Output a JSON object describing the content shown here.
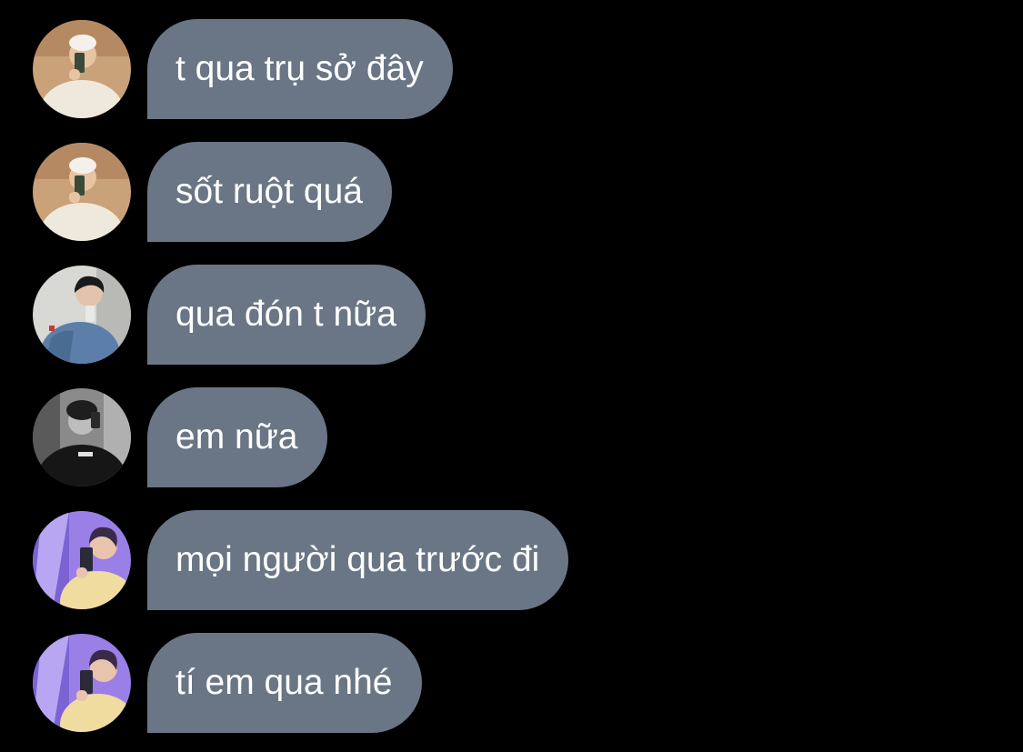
{
  "conversation": {
    "messages": [
      {
        "avatar": "user-a-avatar",
        "text": "t qua trụ sở đây"
      },
      {
        "avatar": "user-a-avatar",
        "text": "sốt ruột quá"
      },
      {
        "avatar": "user-b-avatar",
        "text": "qua đón t nữa"
      },
      {
        "avatar": "user-c-avatar",
        "text": "em nữa"
      },
      {
        "avatar": "user-d-avatar",
        "text": "mọi người qua trước đi"
      },
      {
        "avatar": "user-d-avatar",
        "text": "tí em qua nhé"
      }
    ]
  },
  "colors": {
    "background": "#000000",
    "bubble": "#6a7686",
    "bubble_text": "#ffffff"
  }
}
